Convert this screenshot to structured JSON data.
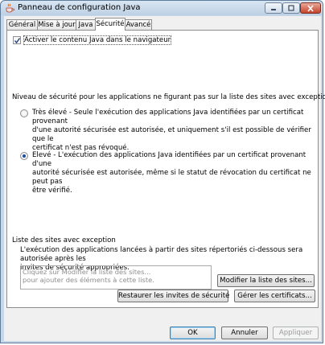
{
  "window": {
    "title": "Panneau de configuration Java"
  },
  "tabs": [
    {
      "label": "Général"
    },
    {
      "label": "Mise à jour"
    },
    {
      "label": "Java"
    },
    {
      "label": "Sécurité"
    },
    {
      "label": "Avancé"
    }
  ],
  "active_tab": "Sécurité",
  "security": {
    "enable_browser_label": "Activer le contenu Java dans le navigateur",
    "enable_browser_checked": true,
    "level_heading": "Niveau de sécurité pour les applications ne figurant pas sur la liste des sites avec exception",
    "very_high_lines": [
      "Très élevé - Seule l'exécution des applications Java identifiées par un certificat provenant",
      "d'une autorité sécurisée est autorisée, et uniquement s'il est possible de vérifier que le",
      "certificat n'est pas révoqué."
    ],
    "high_lines": [
      "Elevé - L'exécution des applications Java identifiées par un certificat provenant d'une",
      "autorité sécurisée est autorisée, même si le statut de révocation du certificat ne peut pas",
      "être vérifié."
    ],
    "selected_level": "Elevé",
    "exception_heading": "Liste des sites avec exception",
    "exception_desc_lines": [
      "L'exécution des applications lancées à partir des sites répertoriés ci-dessous sera autorisée après les",
      "invites de sécurité appropriées."
    ],
    "exception_placeholder_lines": [
      "Cliquez sur Modifier la liste des sites...",
      "pour ajouter des éléments à cette liste."
    ],
    "edit_sites_button": "Modifier la liste des sites...",
    "restore_prompts_button": "Restaurer les invites de sécurité",
    "manage_certs_button": "Gérer les certificats..."
  },
  "footer": {
    "ok": "OK",
    "cancel": "Annuler",
    "apply": "Appliquer"
  },
  "colors": {
    "title_bar": "#c7d7e8",
    "close_button": "#c5432b",
    "radio_dot": "#1a4b9c"
  }
}
